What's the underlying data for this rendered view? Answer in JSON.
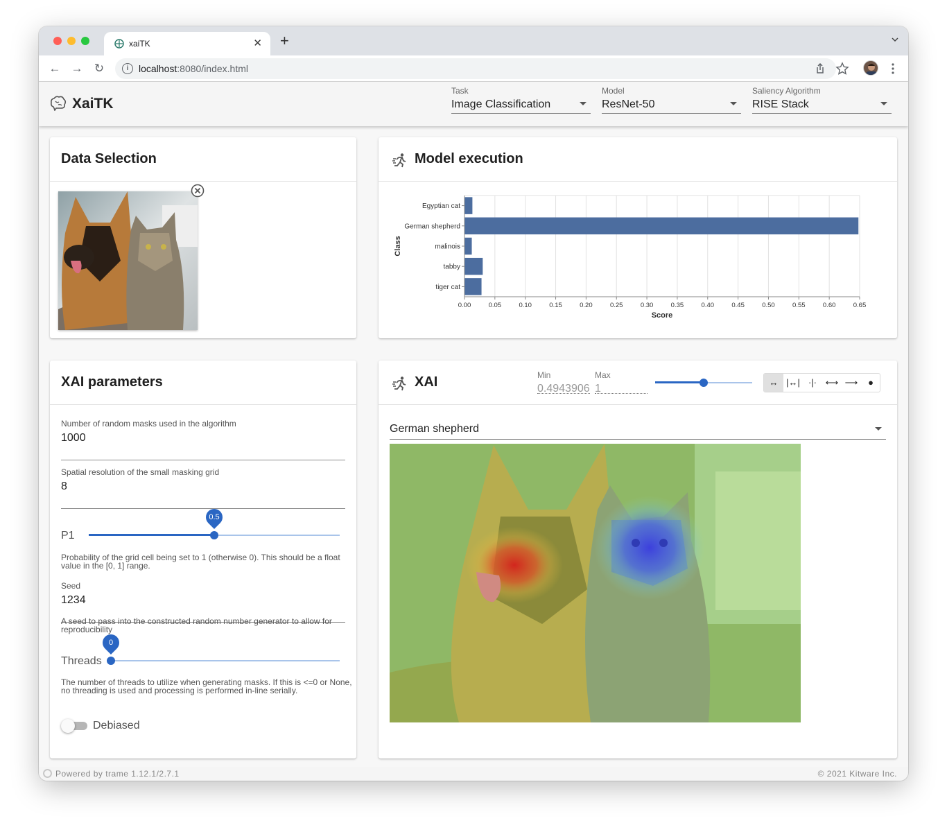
{
  "browser": {
    "tab_title": "xaiTK",
    "url_host": "localhost",
    "url_rest": ":8080/index.html"
  },
  "app": {
    "title": "XaiTK",
    "task": {
      "label": "Task",
      "value": "Image Classification"
    },
    "model": {
      "label": "Model",
      "value": "ResNet-50"
    },
    "saliency": {
      "label": "Saliency Algorithm",
      "value": "RISE Stack"
    }
  },
  "data_selection": {
    "title": "Data Selection"
  },
  "model_execution": {
    "title": "Model execution"
  },
  "chart_data": {
    "type": "bar",
    "orientation": "horizontal",
    "categories": [
      "Egyptian cat",
      "German shepherd",
      "malinois",
      "tabby",
      "tiger cat"
    ],
    "values": [
      0.013,
      0.648,
      0.012,
      0.03,
      0.028
    ],
    "xlabel": "Score",
    "ylabel": "Class",
    "xlim": [
      0,
      0.65
    ],
    "xticks": [
      "0.00",
      "0.05",
      "0.10",
      "0.15",
      "0.20",
      "0.25",
      "0.30",
      "0.35",
      "0.40",
      "0.45",
      "0.50",
      "0.55",
      "0.60",
      "0.65"
    ],
    "grid": true,
    "bar_color": "#4c6d9f"
  },
  "xai_params": {
    "title": "XAI parameters",
    "masks": {
      "label": "Number of random masks used in the algorithm",
      "value": "1000"
    },
    "grid": {
      "label": "Spatial resolution of the small masking grid",
      "value": "8"
    },
    "p1": {
      "label": "P1",
      "value": "0.5",
      "fraction": 0.5,
      "hint": "Probability of the grid cell being set to 1 (otherwise 0). This should be a float value in the [0, 1] range."
    },
    "seed": {
      "label": "Seed",
      "value": "1234",
      "hint": "A seed to pass into the constructed random number generator to allow for reproducibility"
    },
    "threads": {
      "label": "Threads",
      "value": "0",
      "fraction": 0.0,
      "hint": "The number of threads to utilize when generating masks. If this is <=0 or None, no threading is used and processing is performed in-line serially."
    },
    "debiased": {
      "label": "Debiased",
      "checked": false
    }
  },
  "xai": {
    "title": "XAI",
    "min": {
      "label": "Min",
      "value": "0.4943906"
    },
    "max": {
      "label": "Max",
      "value": "1"
    },
    "range_fraction": 0.5,
    "selected_class": "German shepherd",
    "accent": "#2a66c3"
  },
  "footer": {
    "left": "Powered by trame 1.12.1/2.7.1",
    "right": "© 2021 Kitware Inc."
  }
}
